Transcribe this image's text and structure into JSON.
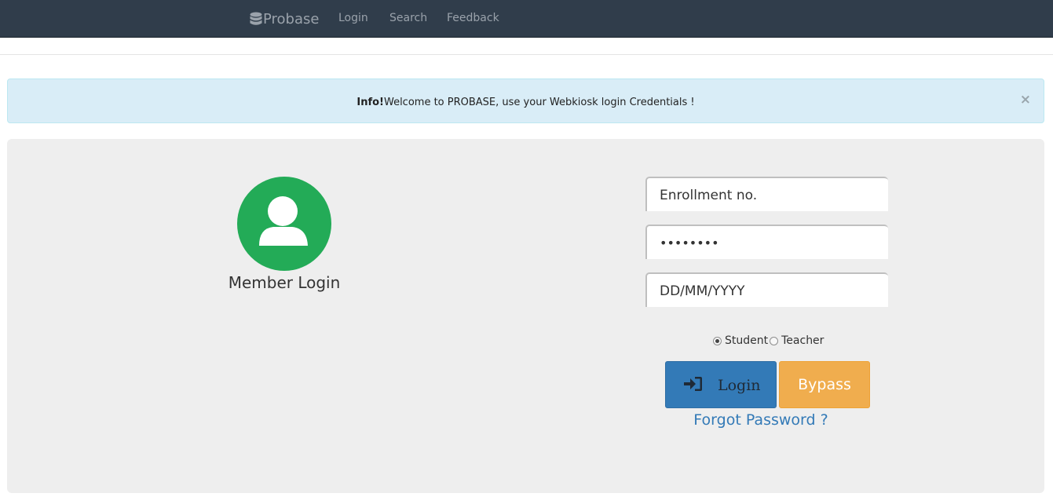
{
  "navbar": {
    "brand": "Probase",
    "brand_icon": "database-icon",
    "links": [
      "Login",
      "Search",
      "Feedback"
    ],
    "background": "#303d4b",
    "text_color": "#9aa2ab"
  },
  "alert": {
    "strong": "Info!",
    "message": "Welcome to PROBASE, use your Webkiosk login Credentials !",
    "close": "×",
    "background": "#d9edf7"
  },
  "login_panel": {
    "avatar_icon": "user-icon",
    "avatar_color": "#23ab57",
    "title": "Member Login",
    "enrollment_placeholder": "Enrollment no.",
    "password_value": "••••••••",
    "dob_placeholder": "DD/MM/YYYY",
    "role_options": [
      {
        "label": "Student",
        "selected": true
      },
      {
        "label": "Teacher",
        "selected": false
      }
    ],
    "login_button": {
      "label": "Login",
      "icon": "sign-in-icon",
      "color": "#337ab7"
    },
    "bypass_button": {
      "label": "Bypass",
      "color": "#f0ad4e"
    },
    "forgot_link": "Forgot Password ?"
  }
}
